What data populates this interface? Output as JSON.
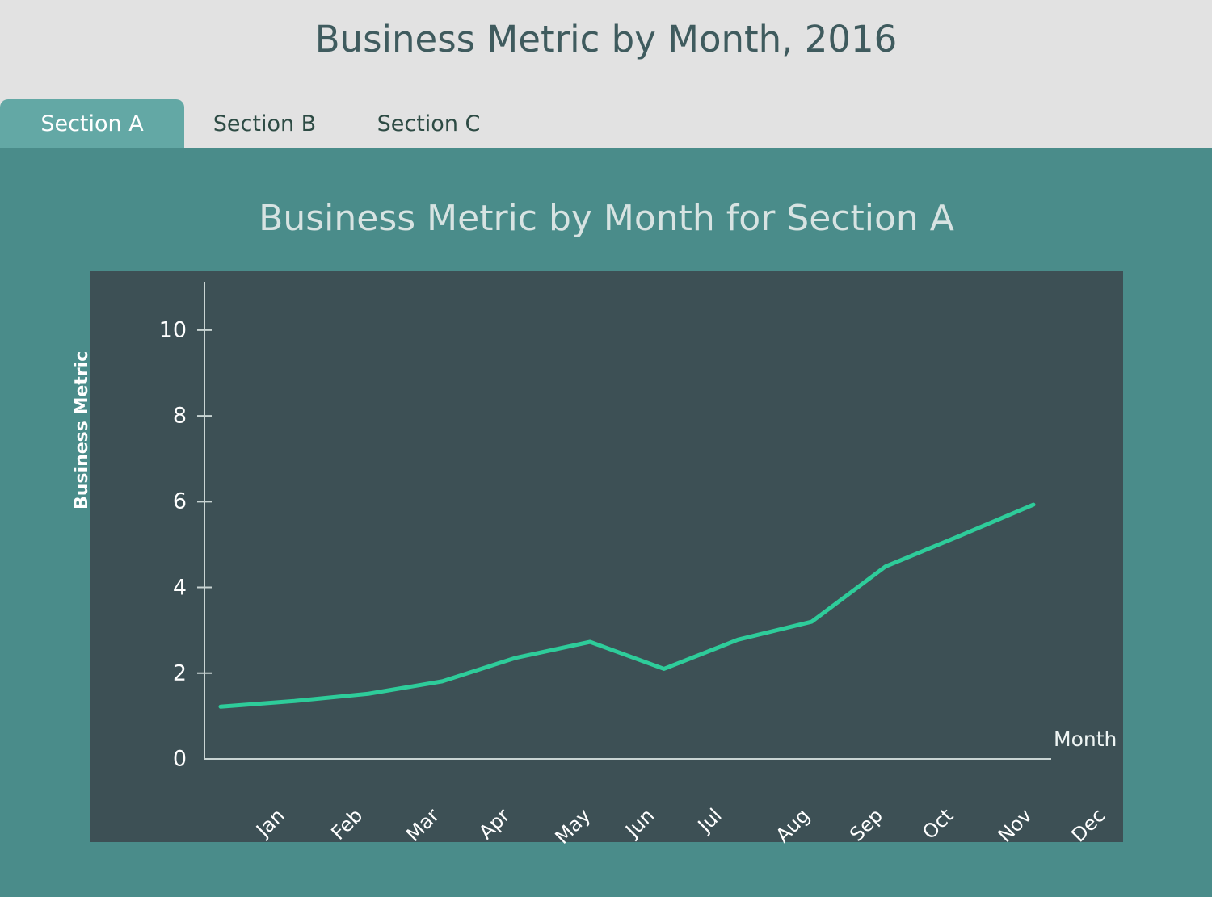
{
  "header": {
    "title": "Business Metric by Month, 2016"
  },
  "tabs": [
    {
      "label": "Section A",
      "active": true
    },
    {
      "label": "Section B",
      "active": false
    },
    {
      "label": "Section C",
      "active": false
    }
  ],
  "colors": {
    "header_bg": "#e2e2e2",
    "panel_bg": "#4a8c8a",
    "plot_bg": "#3d5055",
    "active_tab": "#63a8a5",
    "line": "#2ecc9a",
    "title_text": "#3f5b5e",
    "chart_title_text": "#d7e3e2",
    "axis": "#c9d4d3"
  },
  "chart_data": {
    "type": "line",
    "title": "Business Metric by Month for Section A",
    "xlabel": "Month",
    "ylabel": "Business Metric",
    "categories": [
      "Jan",
      "Feb",
      "Mar",
      "Apr",
      "May",
      "Jun",
      "Jul",
      "Aug",
      "Sep",
      "Oct",
      "Nov",
      "Dec"
    ],
    "values": [
      1.22,
      1.35,
      1.52,
      1.81,
      2.36,
      2.73,
      2.1,
      2.78,
      3.2,
      4.49,
      5.2,
      5.93
    ],
    "series": [
      {
        "name": "Business Metric",
        "color": "#2ecc9a",
        "values": [
          1.22,
          1.35,
          1.52,
          1.81,
          2.36,
          2.73,
          2.1,
          2.78,
          3.2,
          4.49,
          5.2,
          5.93
        ]
      }
    ],
    "ylim": [
      0,
      10.6
    ],
    "yticks": [
      0,
      2,
      4,
      6,
      8,
      10
    ],
    "grid": false,
    "legend": "none",
    "marker": "none",
    "line_width": 5
  }
}
